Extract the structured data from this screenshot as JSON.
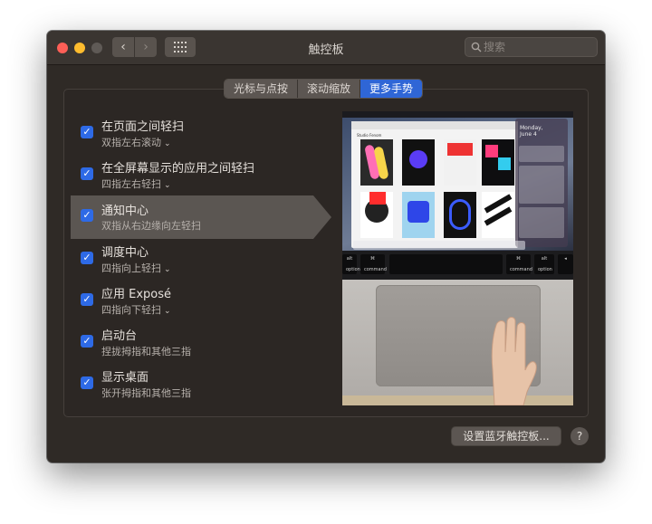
{
  "window": {
    "title": "触控板",
    "search": {
      "placeholder": "搜索",
      "value": ""
    }
  },
  "tabs": [
    {
      "label": "光标与点按",
      "active": false
    },
    {
      "label": "滚动缩放",
      "active": false
    },
    {
      "label": "更多手势",
      "active": true
    }
  ],
  "gestures": [
    {
      "title": "在页面之间轻扫",
      "subtitle": "双指左右滚动",
      "checked": true,
      "selected": false,
      "has_dropdown": true
    },
    {
      "title": "在全屏幕显示的应用之间轻扫",
      "subtitle": "四指左右轻扫",
      "checked": true,
      "selected": false,
      "has_dropdown": true
    },
    {
      "title": "通知中心",
      "subtitle": "双指从右边缘向左轻扫",
      "checked": true,
      "selected": true,
      "has_dropdown": false
    },
    {
      "title": "调度中心",
      "subtitle": "四指向上轻扫",
      "checked": true,
      "selected": false,
      "has_dropdown": true
    },
    {
      "title": "应用 Exposé",
      "subtitle": "四指向下轻扫",
      "checked": true,
      "selected": false,
      "has_dropdown": true
    },
    {
      "title": "启动台",
      "subtitle": "捏拢拇指和其他三指",
      "checked": true,
      "selected": false,
      "has_dropdown": false
    },
    {
      "title": "显示桌面",
      "subtitle": "张开拇指和其他三指",
      "checked": true,
      "selected": false,
      "has_dropdown": false
    }
  ],
  "preview": {
    "app_label": "Studio Fenom",
    "nc_date_line1": "Monday,",
    "nc_date_line2": "June 4",
    "key_command": "command",
    "key_option": "option",
    "key_alt": "alt",
    "key_cmd_symbol": "⌘"
  },
  "footer": {
    "bluetooth_button": "设置蓝牙触控板...",
    "help_button": "?"
  },
  "colors": {
    "accent": "#2f66d6",
    "window_bg": "#2f2a26",
    "selection": "#5b5652"
  }
}
